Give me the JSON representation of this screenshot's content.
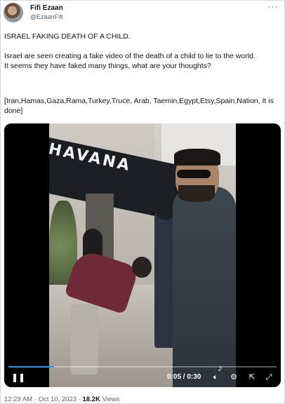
{
  "author": {
    "name": "Fifi Ezaan",
    "handle": "@EzaanFifi"
  },
  "tweet": {
    "line1": "ISRAEL FAKING DEATH OF A CHILD.",
    "paragraph2": "Israel are seen creating a fake video of the death of a child to lie to the world.\nIt seems they have faked many things, what are your thoughts?",
    "paragraph3": "[Iran,Hamas,Gaza,Rama,Turkey,Truce, Arab, Taemin,Egypt,Etsy,Spain,Nation, It is done]"
  },
  "video": {
    "sign_text": "HAVANA",
    "time": "0:05 / 0:30",
    "progress": 0.17,
    "watermark_icon": "tiktok-icon"
  },
  "icons": {
    "more": "more-icon",
    "play": "pause-icon",
    "volume": "volume-icon",
    "settings": "settings-icon",
    "captions": "captions-icon",
    "fullscreen": "fullscreen-icon"
  },
  "meta": {
    "time": "12:29 AM",
    "separator": "·",
    "date": "Oct 10, 2023",
    "views_count": "18.2K",
    "views_label": "Views"
  },
  "colors": {
    "accent": "#1d9bf0",
    "secondary_text": "#536471"
  }
}
